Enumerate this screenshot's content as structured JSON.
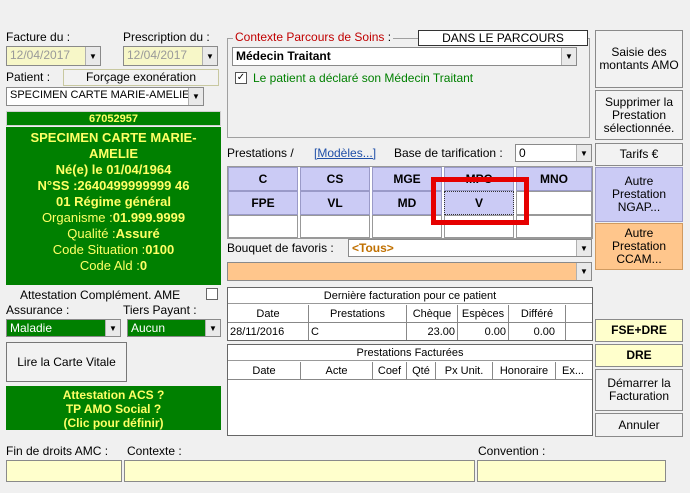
{
  "header": {
    "facture_label": "Facture du :",
    "facture_date": "12/04/2017",
    "prescription_label": "Prescription du :",
    "prescription_date": "12/04/2017",
    "patient_label": "Patient :",
    "forcage_label": "Forçage exonération",
    "patient_name": "SPECIMEN CARTE MARIE-AMELIE"
  },
  "patient_card": {
    "number": "67052957",
    "line1": "SPECIMEN CARTE MARIE-",
    "line2": "AMELIE",
    "line3": "Né(e) le 01/04/1964",
    "line4": "N°SS :2640499999999 46",
    "line5": "01 Régime général",
    "organisme_label": "Organisme :",
    "organisme_value": "01.999.9999",
    "qualite_label": "Qualité :",
    "qualite_value": "Assuré",
    "code_situation_label": "Code Situation :",
    "code_situation_value": "0100",
    "code_ald_label": "Code Ald :",
    "code_ald_value": "0"
  },
  "left": {
    "attestation_label": "Attestation Complément. AME",
    "assurance_label": "Assurance :",
    "assurance_value": "Maladie",
    "tiers_label": "Tiers Payant :",
    "tiers_value": "Aucun",
    "lire_carte": "Lire la Carte Vitale",
    "acs_line1": "Attestation ACS ?",
    "acs_line2": "TP AMO Social ?",
    "acs_line3": "(Clic pour définir)"
  },
  "contexte": {
    "title": "Contexte Parcours de Soins",
    "colon": ":",
    "badge": "DANS LE PARCOURS",
    "medecin": "Médecin Traitant",
    "checkbox_label": "Le patient a déclaré son Médecin Traitant"
  },
  "prestations": {
    "label": "Prestations /",
    "modeles_link": "[Modèles...]",
    "base_label": "Base de tarification :",
    "base_value": "0",
    "row1": [
      "C",
      "CS",
      "MGE",
      "MPC",
      "MNO"
    ],
    "row2": [
      "FPE",
      "VL",
      "MD",
      "V"
    ],
    "bouquet_label": "Bouquet de favoris :",
    "bouquet_value": "<Tous>"
  },
  "derniere": {
    "title": "Dernière facturation pour ce patient",
    "headers": [
      "Date",
      "Prestations",
      "Chèque",
      "Espèces",
      "Différé"
    ],
    "row": [
      "28/11/2016",
      "C",
      "23.00",
      "0.00",
      "0.00"
    ]
  },
  "factures": {
    "title": "Prestations Facturées",
    "headers": [
      "Date",
      "Acte",
      "Coef",
      "Qté",
      "Px Unit.",
      "Honoraire",
      "Ex..."
    ]
  },
  "right_buttons": {
    "saisie": "Saisie des montants AMO",
    "supprimer": "Supprimer la Prestation sélectionnée.",
    "tarifs": "Tarifs €",
    "autre_ngap": "Autre Prestation NGAP...",
    "autre_ccam": "Autre Prestation CCAM...",
    "fse_dre": "FSE+DRE",
    "dre": "DRE",
    "demarrer": "Démarrer la Facturation",
    "annuler": "Annuler"
  },
  "footer": {
    "fin_droits": "Fin de droits AMC :",
    "contexte": "Contexte :",
    "convention": "Convention :"
  },
  "colors": {
    "green": "#008000",
    "yellow_text": "#ffff66",
    "tile": "#cbcbf5",
    "orange": "#ffc68c",
    "highlight": "#e60000"
  }
}
